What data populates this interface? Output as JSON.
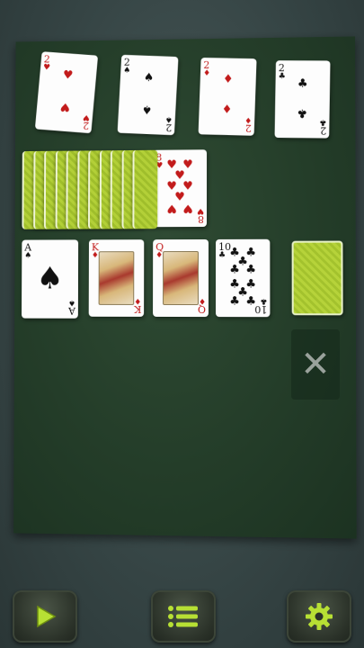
{
  "foundations": [
    {
      "rank": "2",
      "suit": "♥",
      "color": "red"
    },
    {
      "rank": "2",
      "suit": "♠",
      "color": "black"
    },
    {
      "rank": "2",
      "suit": "♦",
      "color": "red"
    },
    {
      "rank": "2",
      "suit": "♣",
      "color": "black"
    }
  ],
  "waste": {
    "rank": "8",
    "suit": "♥",
    "color": "red"
  },
  "tableau": [
    {
      "rank": "A",
      "suit": "♠",
      "color": "black"
    },
    {
      "rank": "K",
      "suit": "♦",
      "color": "red"
    },
    {
      "rank": "Q",
      "suit": "♦",
      "color": "red"
    },
    {
      "rank": "10",
      "suit": "♣",
      "color": "black"
    }
  ],
  "stock_strip_count": 11,
  "discard_symbol": "✕",
  "toolbar": {
    "play_icon": "play-icon",
    "menu_icon": "menu-list-icon",
    "settings_icon": "gear-icon"
  },
  "colors": {
    "felt": "#243d29",
    "card_back": "#b6d33a",
    "accent": "#b7e034"
  }
}
